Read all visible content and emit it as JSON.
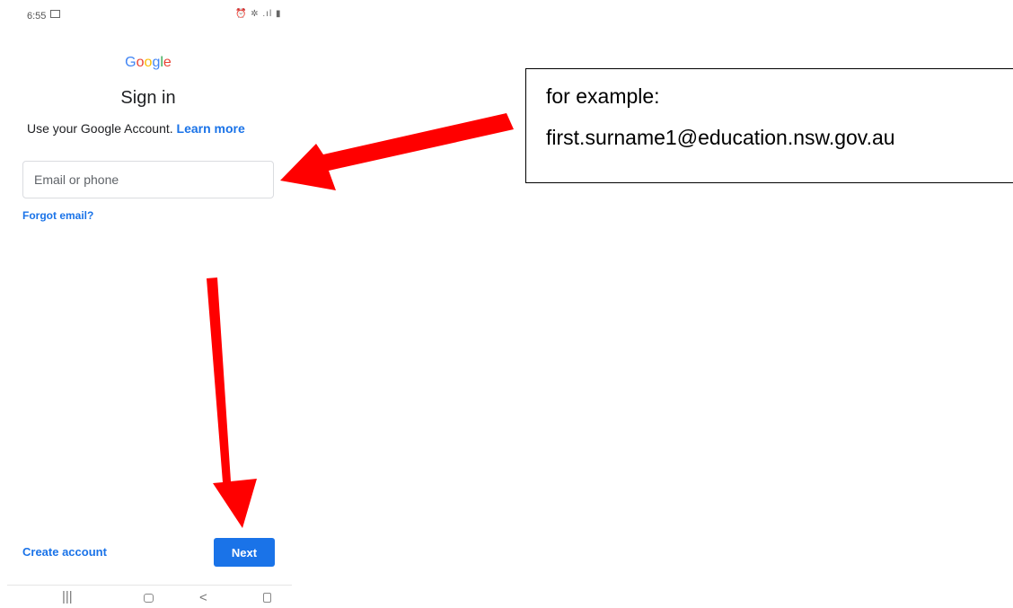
{
  "status_bar": {
    "time": "6:55",
    "icons": [
      "image-icon",
      "alarm-icon",
      "wifi-icon",
      "signal-icon",
      "battery-icon"
    ]
  },
  "logo": {
    "text": "Google",
    "letters": [
      {
        "char": "G",
        "color": "#4285F4"
      },
      {
        "char": "o",
        "color": "#EA4335"
      },
      {
        "char": "o",
        "color": "#FBBC05"
      },
      {
        "char": "g",
        "color": "#4285F4"
      },
      {
        "char": "l",
        "color": "#34A853"
      },
      {
        "char": "e",
        "color": "#EA4335"
      }
    ]
  },
  "signin": {
    "title": "Sign in",
    "subtitle": "Use your Google Account.",
    "learn_more": "Learn more",
    "email_placeholder": "Email or phone",
    "email_value": "",
    "forgot_email": "Forgot email?",
    "create_account": "Create account",
    "next": "Next"
  },
  "nav_bar": {
    "recents": "|||",
    "back": "<"
  },
  "annotation": {
    "line1": "for example:",
    "line2": "first.surname1@education.nsw.gov.au",
    "arrow_color": "#FF0000"
  },
  "colors": {
    "accent": "#1a73e8",
    "text": "#202124"
  }
}
